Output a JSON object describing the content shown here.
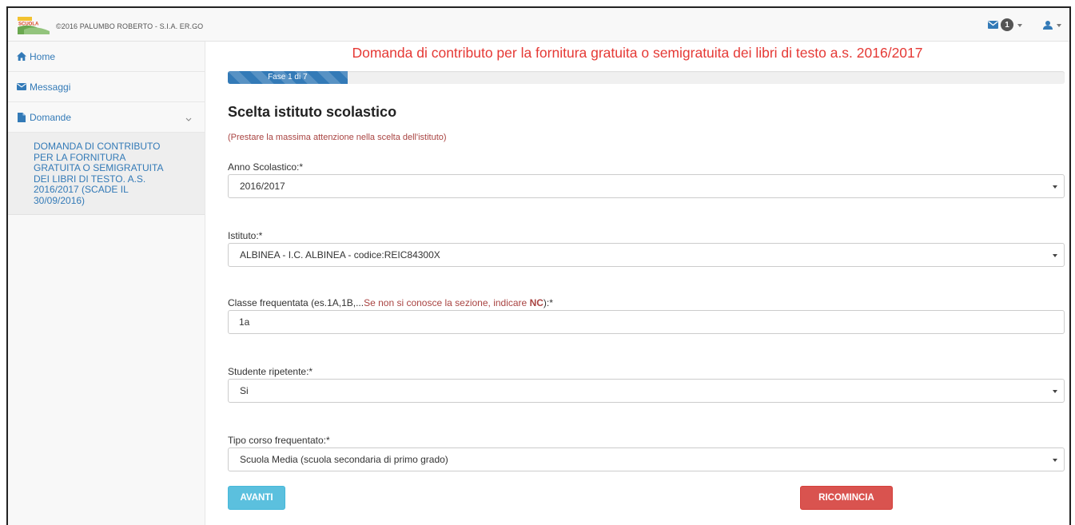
{
  "colors": {
    "accent": "#337ab7",
    "title_red": "#e53935",
    "notice_red": "#a94442",
    "btn_info": "#5bc0de",
    "btn_danger": "#d9534f"
  },
  "header": {
    "logo_icon": "scuola-logo",
    "copyright": "©2016 PALUMBO ROBERTO - S.I.A. ER.GO",
    "messages_badge": "1",
    "mail_icon": "envelope-icon",
    "user_icon": "user-icon"
  },
  "sidebar": {
    "items": [
      {
        "label": "Home",
        "icon": "home-icon"
      },
      {
        "label": "Messaggi",
        "icon": "envelope-icon"
      },
      {
        "label": "Domande",
        "icon": "file-icon"
      }
    ],
    "submenu_lines": [
      "DOMANDA DI CONTRIBUTO",
      "PER LA FORNITURA",
      "GRATUITA O SEMIGRATUITA",
      "DEI LIBRI DI TESTO. A.S.",
      "2016/2017 (Scade il",
      "30/09/2016)"
    ]
  },
  "main": {
    "title": "Domanda di contributo per la fornitura gratuita o semigratuita dei libri di testo a.s. 2016/2017",
    "progress": {
      "label": "Fase 1 di 7",
      "fraction": 0.1429
    },
    "section_title": "Scelta istituto scolastico",
    "notice": "(Prestare la massima attenzione nella scelta dell'istituto)",
    "fields": {
      "anno": {
        "label": "Anno Scolastico:*",
        "value": "2016/2017"
      },
      "istituto": {
        "label": "Istituto:*",
        "value": "ALBINEA - I.C. ALBINEA - codice:REIC84300X"
      },
      "classe": {
        "label_prefix": "Classe frequentata (es.1A,1B,...",
        "label_hint": "Se non si conosce la sezione, indicare ",
        "label_hint_bold": "NC",
        "label_suffix": "):*",
        "value": "1a"
      },
      "ripetente": {
        "label": "Studente ripetente:*",
        "value": "Si"
      },
      "corso": {
        "label": "Tipo corso frequentato:*",
        "value": "Scuola Media (scuola secondaria di primo grado)"
      }
    },
    "buttons": {
      "next": "AVANTI",
      "restart": "RICOMINCIA"
    }
  }
}
